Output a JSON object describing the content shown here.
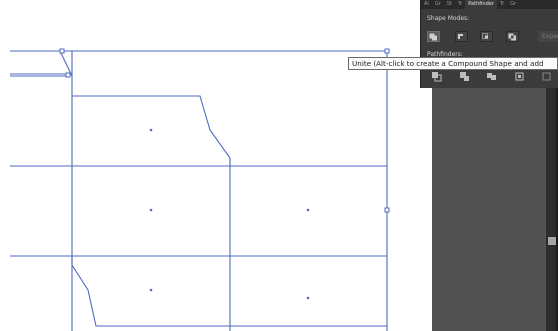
{
  "panel": {
    "tabs": [
      "Al",
      "Gr",
      "St",
      "Tr",
      "Pathfinder",
      "Tr",
      "Gr"
    ],
    "active_tab_index": 4,
    "shape_modes_label": "Shape Modes:",
    "pathfinders_label": "Pathfinders:",
    "expand_label": "Expand",
    "shape_mode_buttons": [
      {
        "name": "unite-mode-button",
        "icon": "unite-icon",
        "selected": true
      },
      {
        "name": "minus-front-mode-button",
        "icon": "minus-front-icon",
        "selected": false
      },
      {
        "name": "intersect-mode-button",
        "icon": "intersect-icon",
        "selected": false
      },
      {
        "name": "exclude-mode-button",
        "icon": "exclude-icon",
        "selected": false
      }
    ],
    "pathfinder_buttons": [
      {
        "name": "divide-button",
        "icon": "divide-icon"
      },
      {
        "name": "trim-button",
        "icon": "trim-icon"
      },
      {
        "name": "merge-button",
        "icon": "merge-icon"
      },
      {
        "name": "crop-button",
        "icon": "crop-icon"
      },
      {
        "name": "outline-button",
        "icon": "outline-icon"
      }
    ]
  },
  "tooltip": {
    "text": "Unite (Alt-click to create a Compound Shape and add"
  },
  "colors": {
    "path_stroke": "#4d6bbf",
    "panel_bg": "#3b3b3b",
    "workspace_dark": "#525252",
    "canvas_bg": "#ffffff"
  }
}
